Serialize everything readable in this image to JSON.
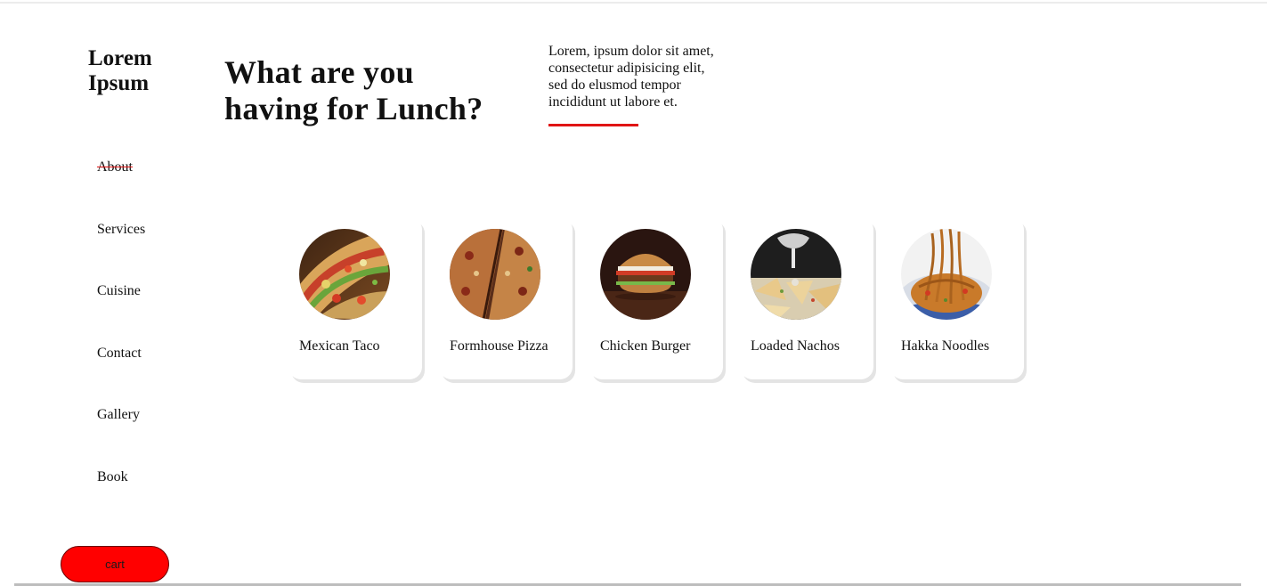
{
  "brand": {
    "line1": "Lorem",
    "line2": "Ipsum"
  },
  "nav": {
    "items": [
      {
        "label": "About",
        "active": true
      },
      {
        "label": "Services"
      },
      {
        "label": "Cuisine"
      },
      {
        "label": "Contact"
      },
      {
        "label": "Gallery"
      },
      {
        "label": "Book"
      }
    ]
  },
  "hero": {
    "headline_line1": "What are you",
    "headline_line2": "having for Lunch?",
    "intro": "Lorem, ipsum dolor sit amet, consectetur adipisicing elit, sed do elusmod tempor incididunt ut labore et."
  },
  "dishes": [
    {
      "name": "Mexican Taco",
      "icon": "taco-photo"
    },
    {
      "name": "Formhouse Pizza",
      "icon": "pizza-photo"
    },
    {
      "name": "Chicken Burger",
      "icon": "burger-photo"
    },
    {
      "name": "Loaded Nachos",
      "icon": "nachos-photo"
    },
    {
      "name": "Hakka Noodles",
      "icon": "noodles-photo"
    }
  ],
  "cart": {
    "label": "cart"
  },
  "colors": {
    "accent": "#e01414",
    "cart_button": "#ff0000"
  }
}
